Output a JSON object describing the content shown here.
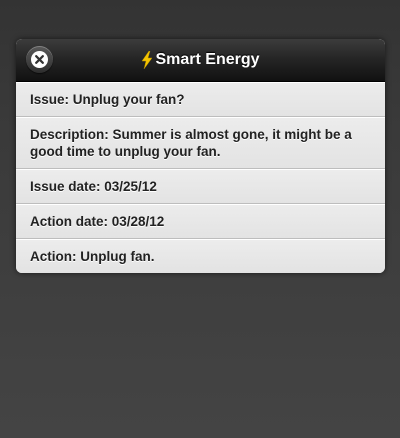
{
  "header": {
    "title": "Smart Energy",
    "icon": "lightning-bolt-icon",
    "close_icon": "close-icon",
    "accent_color": "#f5c400"
  },
  "items": [
    {
      "text": "Issue: Unplug your fan?"
    },
    {
      "text": "Description: Summer is almost gone, it might be a good time to unplug your fan."
    },
    {
      "text": "Issue date: 03/25/12"
    },
    {
      "text": "Action date: 03/28/12"
    },
    {
      "text": "Action: Unplug fan."
    }
  ]
}
